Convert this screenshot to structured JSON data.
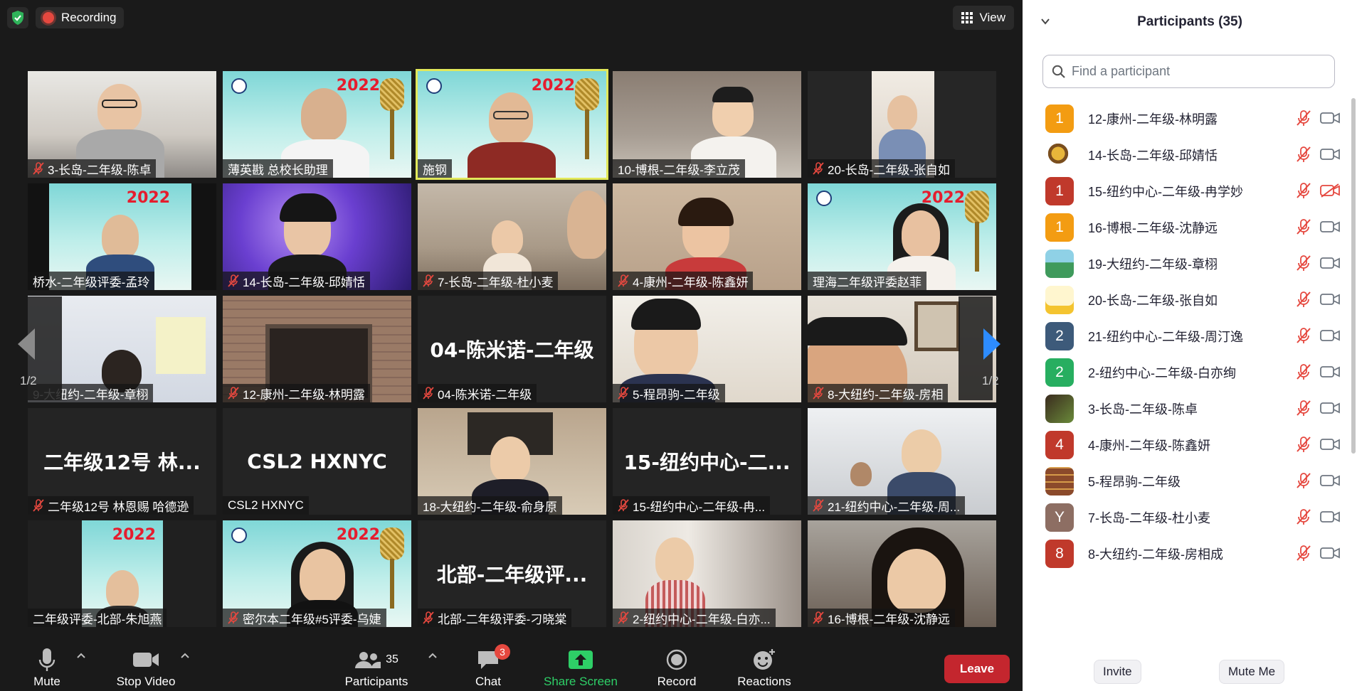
{
  "top_bar": {
    "recording_label": "Recording",
    "view_label": "View"
  },
  "gallery": {
    "page_indicator": "1/2",
    "tiles": [
      {
        "name": "3-长岛-二年级-陈卓",
        "muted": true
      },
      {
        "name": "薄英戡 总校长助理",
        "muted": false
      },
      {
        "name": "施钢",
        "muted": false,
        "active": true
      },
      {
        "name": "10-博根-二年级-李立茂",
        "muted": false
      },
      {
        "name": "20-长岛-二年级-张自如",
        "muted": true
      },
      {
        "name": "桥水-二年级评委-孟玲",
        "muted": false
      },
      {
        "name": "14-长岛-二年级-邱婧恬",
        "muted": true
      },
      {
        "name": "7-长岛-二年级-杜小麦",
        "muted": true
      },
      {
        "name": "4-康州-二年级-陈鑫妍",
        "muted": true
      },
      {
        "name": "理海二年级评委赵菲",
        "muted": false
      },
      {
        "name": "9-大纽约-二年级-章栩",
        "muted": false
      },
      {
        "name": "12-康州-二年级-林明露",
        "muted": true
      },
      {
        "name": "04-陈米诺-二年级",
        "muted": true,
        "display_name": "04-陈米诺-二年级"
      },
      {
        "name": "5-程昂驹-二年级",
        "muted": true
      },
      {
        "name": "8-大纽约-二年级-房相",
        "muted": true
      },
      {
        "name": "二年级12号 林恩赐 哈德逊",
        "muted": true,
        "display_name": "二年级12号 林..."
      },
      {
        "name": "CSL2 HXNYC",
        "muted": false,
        "display_name": "CSL2 HXNYC"
      },
      {
        "name": "18-大纽约-二年级-俞身原",
        "muted": false
      },
      {
        "name": "15-纽约中心-二年级-冉...",
        "muted": true,
        "display_name": "15-纽约中心-二..."
      },
      {
        "name": "21-纽约中心-二年级-周...",
        "muted": true
      },
      {
        "name": "二年级评委-北部-朱旭燕",
        "muted": false
      },
      {
        "name": "密尔本二年级#5评委-乌婕",
        "muted": true
      },
      {
        "name": "北部-二年级评委-刁晓棠",
        "muted": true,
        "display_name": "北部-二年级评..."
      },
      {
        "name": "2-纽约中心-二年级-白亦...",
        "muted": true
      },
      {
        "name": "16-博根-二年级-沈静远",
        "muted": true
      }
    ]
  },
  "toolbar": {
    "mute_label": "Mute",
    "stop_video_label": "Stop Video",
    "participants_label": "Participants",
    "participants_count": "35",
    "chat_label": "Chat",
    "chat_badge": "3",
    "share_screen_label": "Share Screen",
    "record_label": "Record",
    "reactions_label": "Reactions",
    "leave_label": "Leave"
  },
  "panel": {
    "title": "Participants (35)",
    "search_placeholder": "Find a participant",
    "invite_label": "Invite",
    "mute_me_label": "Mute Me",
    "participants": [
      {
        "avatar": "1",
        "color": "#f39c12",
        "name": "12-康州-二年级-林明露",
        "cam_off": false
      },
      {
        "avatar": "",
        "color": "#ffffff",
        "name": "14-长岛-二年级-邱婧恬",
        "cam_off": false,
        "image": "dragon"
      },
      {
        "avatar": "1",
        "color": "#c0392b",
        "name": "15-纽约中心-二年级-冉学妙",
        "cam_off": true
      },
      {
        "avatar": "1",
        "color": "#f39c12",
        "name": "16-博根-二年级-沈静远",
        "cam_off": false
      },
      {
        "avatar": "",
        "color": "#ffffff",
        "name": "19-大纽约-二年级-章栩",
        "cam_off": false,
        "image": "landscape"
      },
      {
        "avatar": "",
        "color": "#ffffff",
        "name": "20-长岛-二年级-张自如",
        "cam_off": false,
        "image": "chick"
      },
      {
        "avatar": "2",
        "color": "#3d5a7a",
        "name": "21-纽约中心-二年级-周汀逸",
        "cam_off": false
      },
      {
        "avatar": "2",
        "color": "#27ae60",
        "name": "2-纽约中心-二年级-白亦绚",
        "cam_off": false
      },
      {
        "avatar": "",
        "color": "#ffffff",
        "name": "3-长岛-二年级-陈卓",
        "cam_off": false,
        "image": "game"
      },
      {
        "avatar": "4",
        "color": "#c0392b",
        "name": "4-康州-二年级-陈鑫妍",
        "cam_off": false
      },
      {
        "avatar": "",
        "color": "#ffffff",
        "name": "5-程昂驹-二年级",
        "cam_off": false,
        "image": "shelf"
      },
      {
        "avatar": "Y",
        "color": "#8d6e63",
        "name": "7-长岛-二年级-杜小麦",
        "cam_off": false
      },
      {
        "avatar": "8",
        "color": "#c0392b",
        "name": "8-大纽约-二年级-房相成",
        "cam_off": false
      }
    ]
  }
}
